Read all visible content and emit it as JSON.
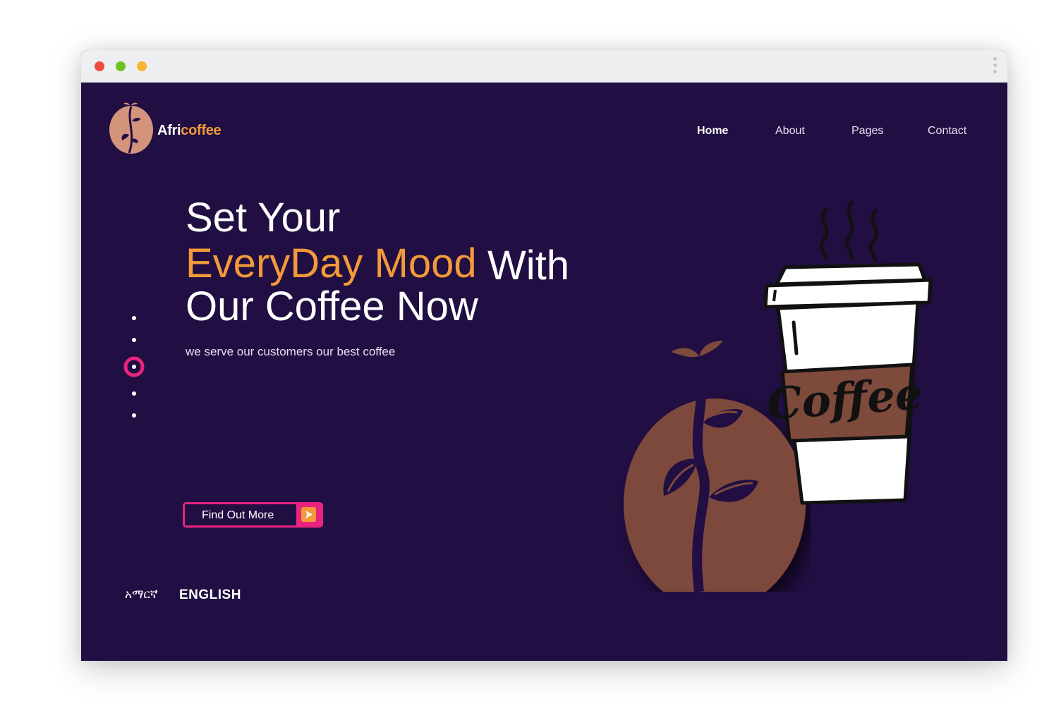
{
  "window": {
    "controls": [
      "close-button",
      "minimize-button",
      "maximize-button"
    ],
    "colors": {
      "close": "#ef4d40",
      "minimize": "#6cc21c",
      "maximize": "#f8b52e"
    }
  },
  "header": {
    "brand_part1": "Afri",
    "brand_part2": "coffee",
    "nav": [
      {
        "label": "Home",
        "active": true
      },
      {
        "label": "About"
      },
      {
        "label": "Pages"
      },
      {
        "label": "Contact"
      }
    ]
  },
  "hero": {
    "line1": "Set Your",
    "line2_highlight": "EveryDay Mood",
    "line2_rest": "With",
    "line3": "Our Coffee Now",
    "subtitle": "we serve our customers our best coffee",
    "cta_label": "Find Out More",
    "cup_lettering": "Coffee"
  },
  "pager": {
    "count": 5,
    "active_index": 2
  },
  "languages": {
    "amharic": "አማርኛ",
    "english": "ENGLISH"
  },
  "colors": {
    "background": "#210e42",
    "accent_orange": "#f29a3a",
    "accent_pink": "#e8247f",
    "bean_brown": "#7d4a3c",
    "logo_tan": "#d4947c"
  },
  "icons": [
    "logo-bean-icon",
    "arrow-right-icon",
    "coffee-bean-illustration",
    "coffee-cup-illustration"
  ]
}
